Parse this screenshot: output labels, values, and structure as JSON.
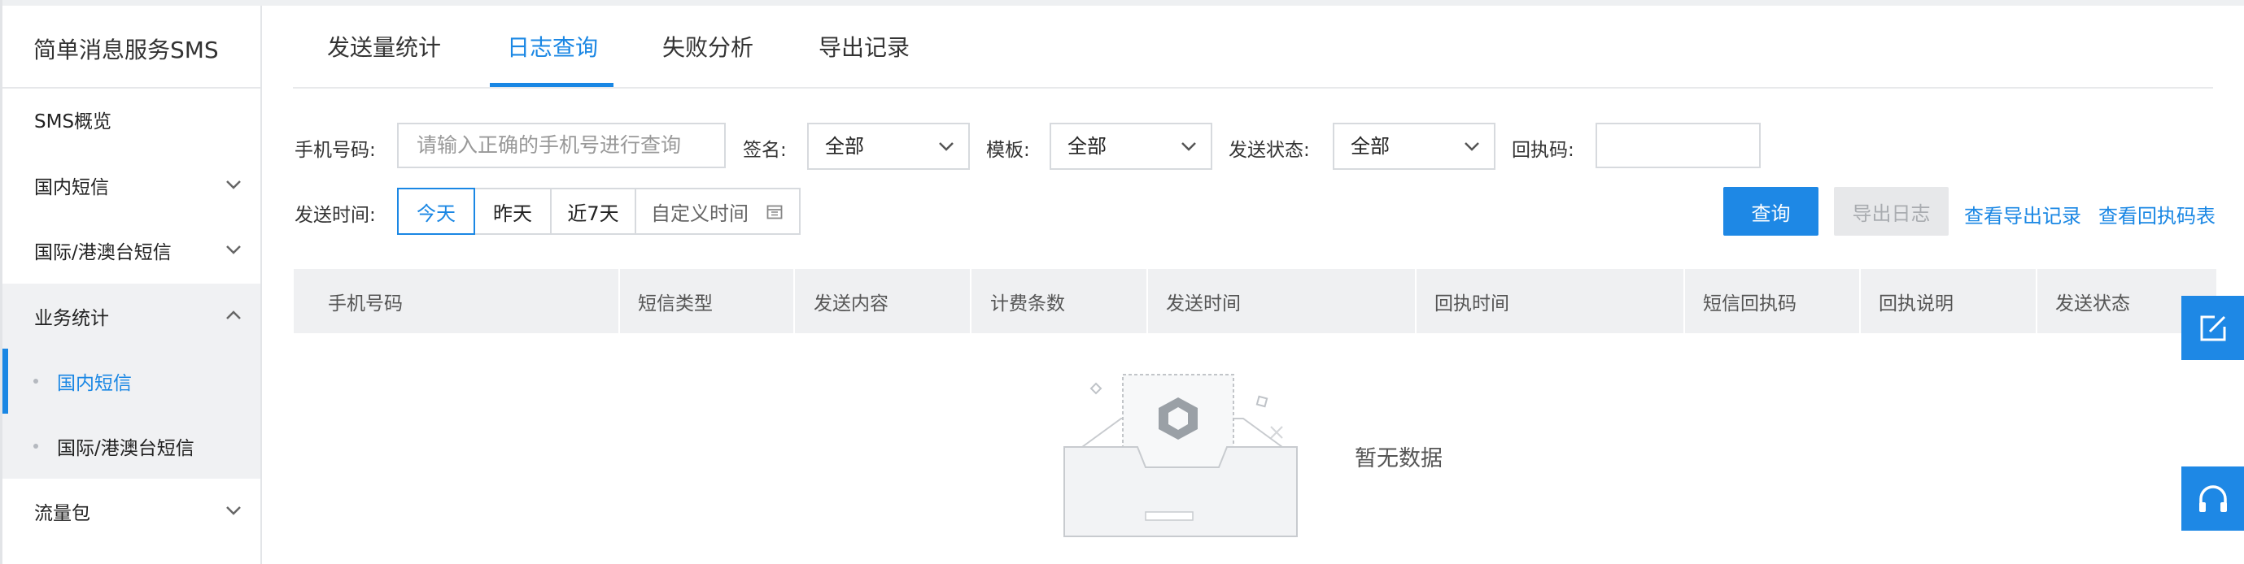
{
  "sidebar": {
    "title": "简单消息服务SMS",
    "items": [
      {
        "label": "SMS概览"
      },
      {
        "label": "国内短信"
      },
      {
        "label": "国际/港澳台短信"
      },
      {
        "label": "业务统计"
      },
      {
        "label": "流量包"
      }
    ],
    "subitems": [
      {
        "label": "国内短信"
      },
      {
        "label": "国际/港澳台短信"
      }
    ]
  },
  "tabs": [
    {
      "label": "发送量统计"
    },
    {
      "label": "日志查询"
    },
    {
      "label": "失败分析"
    },
    {
      "label": "导出记录"
    }
  ],
  "filters": {
    "phone_label": "手机号码:",
    "phone_placeholder": "请输入正确的手机号进行查询",
    "sign_label": "签名:",
    "sign_value": "全部",
    "template_label": "模板:",
    "template_value": "全部",
    "status_label": "发送状态:",
    "status_value": "全部",
    "receipt_label": "回执码:",
    "receipt_value": "",
    "time_label": "发送时间:",
    "time_options": [
      "今天",
      "昨天",
      "近7天",
      "自定义时间"
    ]
  },
  "actions": {
    "query": "查询",
    "export_log": "导出日志",
    "view_exports": "查看导出记录",
    "view_receipt_table": "查看回执码表"
  },
  "table": {
    "columns": [
      "手机号码",
      "短信类型",
      "发送内容",
      "计费条数",
      "发送时间",
      "回执时间",
      "短信回执码",
      "回执说明",
      "发送状态"
    ],
    "empty_text": "暂无数据"
  },
  "colors": {
    "accent": "#1a87e4",
    "primary_button": "#1e88e5",
    "header_bg": "#eff0f2",
    "sidebar_active_bg": "#f0f1f3"
  },
  "icons": {
    "floating": [
      "edit-icon",
      "headset-icon"
    ]
  }
}
